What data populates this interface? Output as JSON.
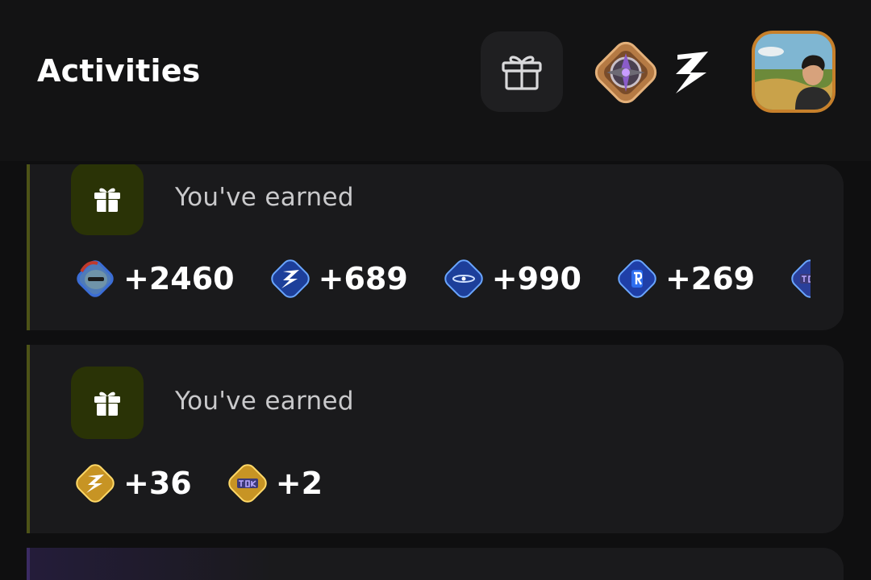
{
  "header": {
    "title": "Activities",
    "icons": [
      "gift-icon",
      "rank-badge-icon",
      "bolt-logo-icon",
      "user-avatar"
    ]
  },
  "activities": [
    {
      "label": "You've earned",
      "icon": "gift-icon",
      "rewards": [
        {
          "token": "pepe-token-icon",
          "amount": "+2460"
        },
        {
          "token": "bolt-token-icon",
          "amount": "+689"
        },
        {
          "token": "ring-token-icon",
          "amount": "+990"
        },
        {
          "token": "r-token-icon",
          "amount": "+269"
        },
        {
          "token": "tok-token-icon",
          "amount": "+"
        }
      ]
    },
    {
      "label": "You've earned",
      "icon": "gift-icon",
      "rewards": [
        {
          "token": "gold-bolt-token-icon",
          "amount": "+36"
        },
        {
          "token": "gold-tok-token-icon",
          "amount": "+2"
        }
      ]
    }
  ],
  "colors": {
    "background": "#0f0f10",
    "card": "#1a1a1c",
    "accent_border": "#4d5317",
    "icon_tile": "#2a3306",
    "token_blue": "#2a5cc8",
    "token_gold": "#e0b33a"
  }
}
